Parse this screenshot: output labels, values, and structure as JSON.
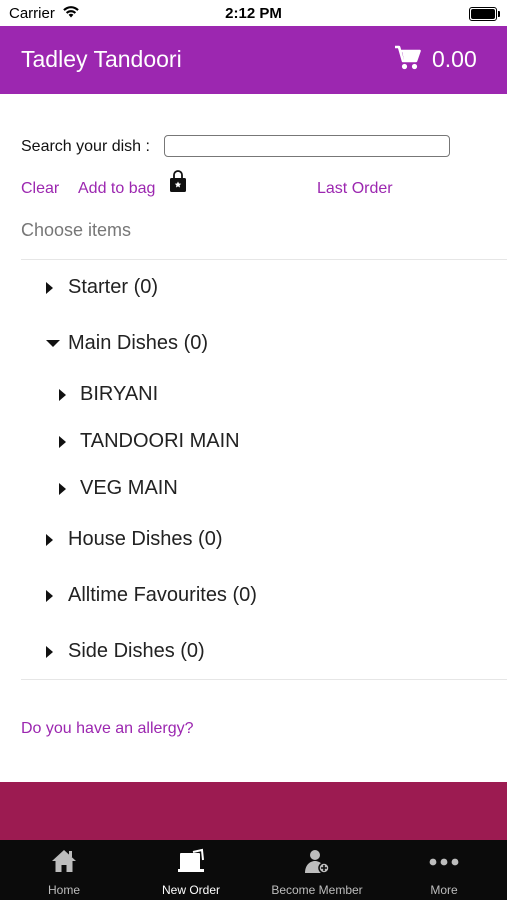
{
  "status_bar": {
    "carrier": "Carrier",
    "time": "2:12 PM"
  },
  "header": {
    "title": "Tadley Tandoori",
    "cart_total": "0.00"
  },
  "search": {
    "label": "Search your dish :",
    "value": "",
    "placeholder": ""
  },
  "actions": {
    "clear": "Clear",
    "add_to_bag": "Add to bag",
    "last_order": "Last Order"
  },
  "choose_label": "Choose items",
  "menu": {
    "starter": "Starter (0)",
    "main_dishes": "Main Dishes (0)",
    "biryani": "BIRYANI",
    "tandoori_main": "TANDOORI MAIN",
    "veg_main": "VEG MAIN",
    "house_dishes": "House Dishes (0)",
    "alltime_favourites": "Alltime Favourites (0)",
    "side_dishes": "Side Dishes (0)"
  },
  "allergy_link": "Do you have an allergy?",
  "tabs": {
    "home": "Home",
    "new_order": "New Order",
    "become_member": "Become Member",
    "more": "More"
  },
  "colors": {
    "brand": "#9c27b0",
    "footer_band": "#9c1b51",
    "tabbar": "#0b0b0b"
  }
}
